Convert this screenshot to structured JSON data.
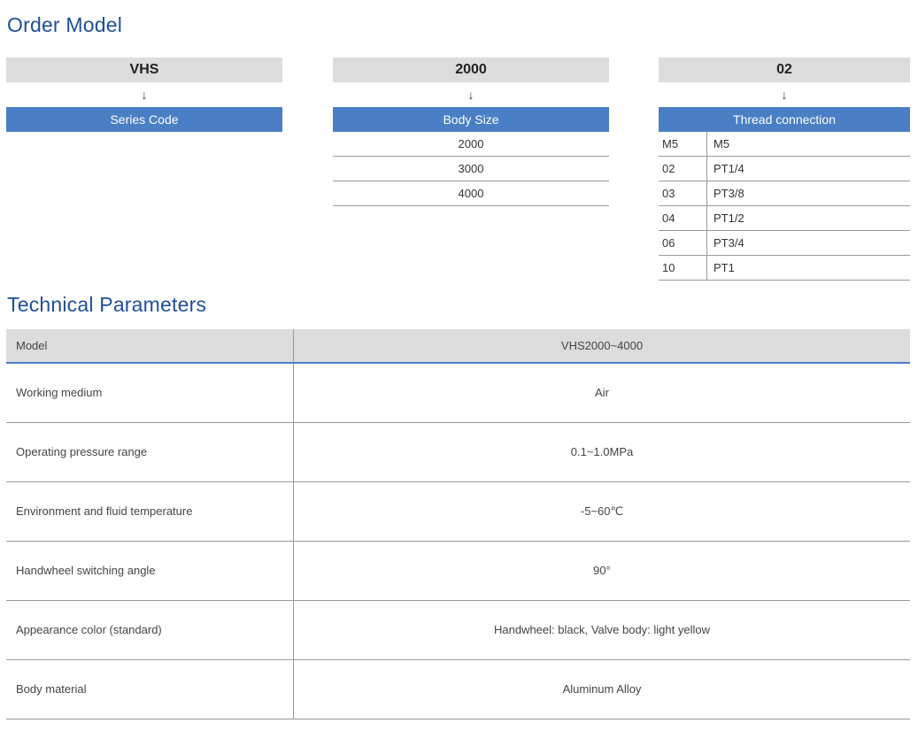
{
  "order_model": {
    "title": "Order Model",
    "series": {
      "code": "VHS",
      "arrow": "↓",
      "header": "Series Code",
      "options": []
    },
    "body_size": {
      "code": "2000",
      "arrow": "↓",
      "header": "Body Size",
      "options": [
        "2000",
        "3000",
        "4000"
      ]
    },
    "thread": {
      "code": "02",
      "arrow": "↓",
      "header": "Thread connection",
      "options": [
        {
          "code": "M5",
          "value": "M5"
        },
        {
          "code": "02",
          "value": "PT1/4"
        },
        {
          "code": "03",
          "value": "PT3/8"
        },
        {
          "code": "04",
          "value": "PT1/2"
        },
        {
          "code": "06",
          "value": "PT3/4"
        },
        {
          "code": "10",
          "value": "PT1"
        }
      ]
    }
  },
  "technical_parameters": {
    "title": "Technical Parameters",
    "header": {
      "param": "Model",
      "value": "VHS2000~4000"
    },
    "rows": [
      {
        "param": "Working medium",
        "value": "Air"
      },
      {
        "param": "Operating pressure range",
        "value": "0.1~1.0MPa"
      },
      {
        "param": "Environment and fluid temperature",
        "value": "-5~60℃"
      },
      {
        "param": "Handwheel switching angle",
        "value": "90°"
      },
      {
        "param": "Appearance color (standard)",
        "value": "Handwheel: black, Valve body: light yellow"
      },
      {
        "param": "Body material",
        "value": "Aluminum Alloy"
      }
    ]
  },
  "colors": {
    "title": "#1f4e9a",
    "header_bar": "#4a7fc6",
    "code_box": "#dcdcdc",
    "divider": "#999999"
  }
}
